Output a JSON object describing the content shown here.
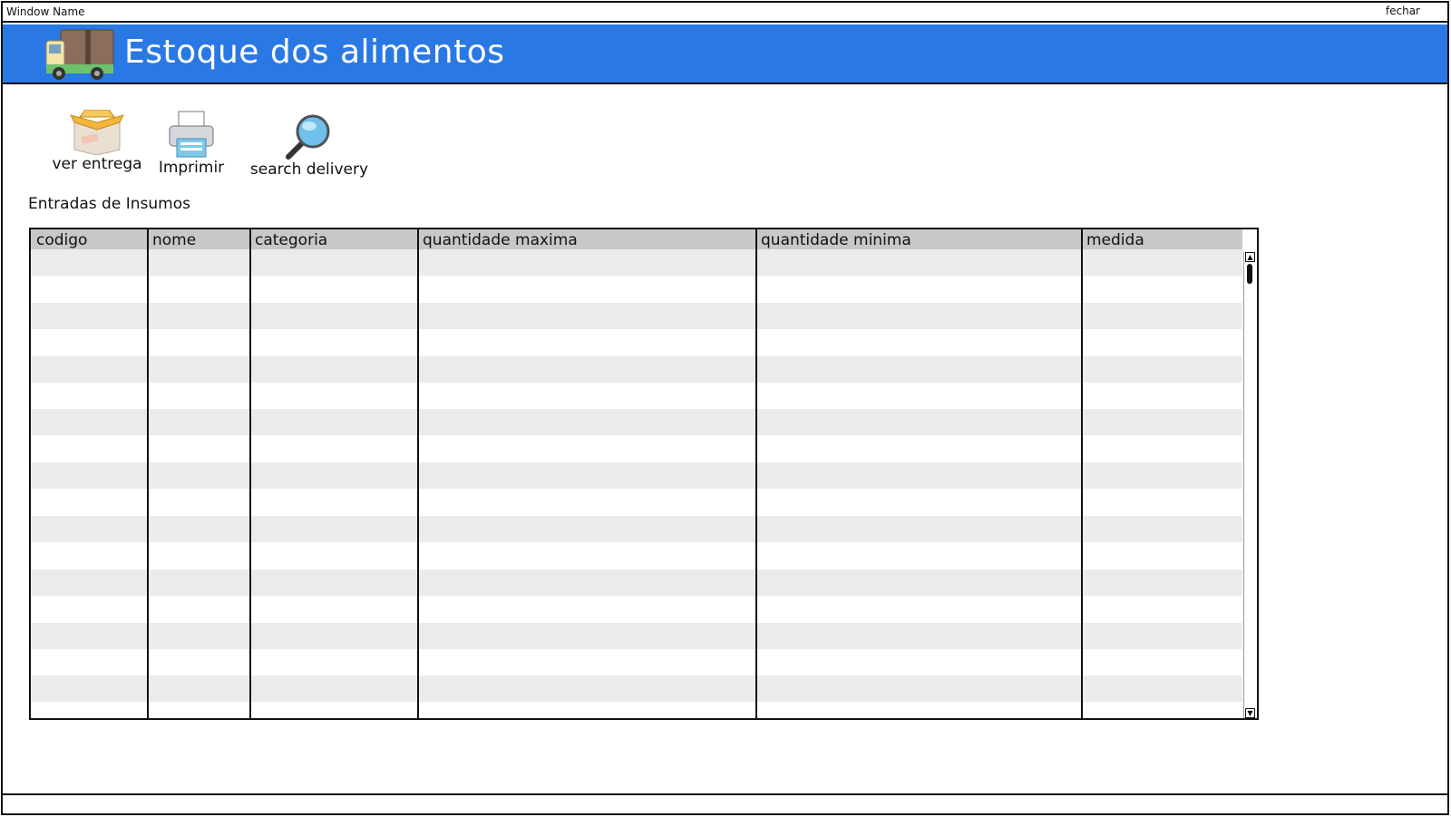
{
  "window": {
    "name": "Window Name",
    "close_label": "fechar"
  },
  "banner": {
    "title": "Estoque dos alimentos",
    "logo_icon": "delivery-truck-icon",
    "color": "#2a78e4"
  },
  "toolbar": [
    {
      "label": "ver entrega",
      "icon": "package-icon"
    },
    {
      "label": "Imprimir",
      "icon": "printer-icon"
    },
    {
      "label": "search delivery",
      "icon": "magnifier-icon"
    }
  ],
  "section": {
    "label": "Entradas de Insumos"
  },
  "table": {
    "columns": [
      "codigo",
      "nome",
      "categoria",
      "quantidade maxima",
      "quantidade minima",
      "medida"
    ],
    "rows": []
  }
}
